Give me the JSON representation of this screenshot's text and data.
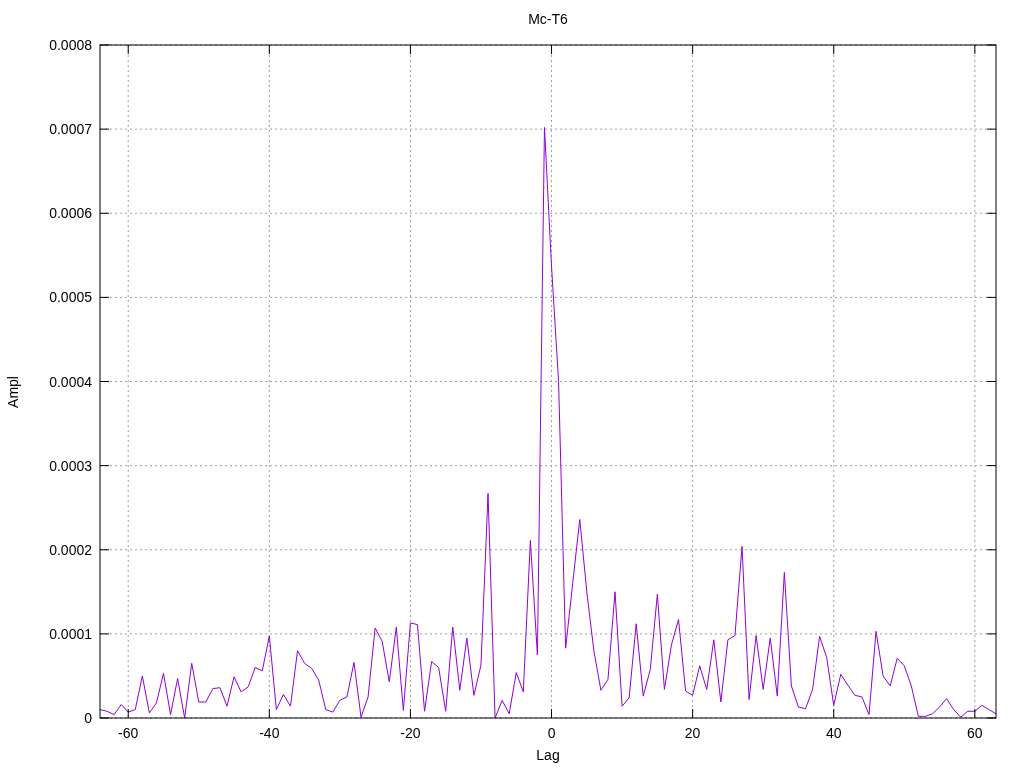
{
  "chart_data": {
    "type": "line",
    "title": "Mc-T6",
    "xlabel": "Lag",
    "ylabel": "Ampl",
    "x": [
      -64,
      -63,
      -62,
      -61,
      -60,
      -59,
      -58,
      -57,
      -56,
      -55,
      -54,
      -53,
      -52,
      -51,
      -50,
      -49,
      -48,
      -47,
      -46,
      -45,
      -44,
      -43,
      -42,
      -41,
      -40,
      -39,
      -38,
      -37,
      -36,
      -35,
      -34,
      -33,
      -32,
      -31,
      -30,
      -29,
      -28,
      -27,
      -26,
      -25,
      -24,
      -23,
      -22,
      -21,
      -20,
      -19,
      -18,
      -17,
      -16,
      -15,
      -14,
      -13,
      -12,
      -11,
      -10,
      -9,
      -8,
      -7,
      -6,
      -5,
      -4,
      -3,
      -2,
      -1,
      0,
      1,
      2,
      3,
      4,
      5,
      6,
      7,
      8,
      9,
      10,
      11,
      12,
      13,
      14,
      15,
      16,
      17,
      18,
      19,
      20,
      21,
      22,
      23,
      24,
      25,
      26,
      27,
      28,
      29,
      30,
      31,
      32,
      33,
      34,
      35,
      36,
      37,
      38,
      39,
      40,
      41,
      42,
      43,
      44,
      45,
      46,
      47,
      48,
      49,
      50,
      51,
      52,
      53,
      54,
      55,
      56,
      57,
      58,
      59,
      60,
      61,
      62,
      63
    ],
    "series": [
      {
        "color": "#9400d3",
        "values": [
          1e-05,
          8e-06,
          4e-06,
          1.6e-05,
          7e-06,
          1e-05,
          5e-05,
          6e-06,
          1.8e-05,
          5.3e-05,
          4e-06,
          4.7e-05,
          0,
          6.5e-05,
          1.9e-05,
          1.9e-05,
          3.5e-05,
          3.6e-05,
          1.4e-05,
          4.9e-05,
          3.1e-05,
          3.7e-05,
          6e-05,
          5.6e-05,
          9.75e-05,
          1e-05,
          2.8e-05,
          1.4e-05,
          8e-05,
          6.5e-05,
          5.9e-05,
          4.5e-05,
          1e-05,
          7e-06,
          2.1e-05,
          2.5e-05,
          6.6e-05,
          1e-06,
          2.5e-05,
          0.000107,
          9.1e-05,
          4.3e-05,
          0.000108,
          9e-06,
          0.000113,
          0.000111,
          8e-06,
          6.7e-05,
          6e-05,
          8e-06,
          0.000108,
          3.3e-05,
          9.5e-05,
          2.7e-05,
          6.3e-05,
          0.000267,
          0,
          2.1e-05,
          5e-06,
          5.4e-05,
          3.1e-05,
          0.000211,
          7.5e-05,
          0.000702,
          0.000537,
          0.0004,
          8.3e-05,
          0.00016,
          0.000236,
          0.00015,
          8e-05,
          3.3e-05,
          4.6e-05,
          0.00015,
          1.4e-05,
          2.4e-05,
          0.000112,
          2.6e-05,
          5.8e-05,
          0.000147,
          3.4e-05,
          8.7e-05,
          0.000117,
          3.2e-05,
          2.7e-05,
          6.2e-05,
          3.4e-05,
          9.3e-05,
          1.9e-05,
          9.3e-05,
          9.8e-05,
          0.000204,
          2.2e-05,
          9.8e-05,
          3.4e-05,
          9.5e-05,
          2.6e-05,
          0.000173,
          3.8e-05,
          1.3e-05,
          1.1e-05,
          3.4e-05,
          9.7e-05,
          7.2e-05,
          1.5e-05,
          5.2e-05,
          3.9e-05,
          2.7e-05,
          2.5e-05,
          4e-06,
          0.000103,
          5e-05,
          3.8e-05,
          7.1e-05,
          6.2e-05,
          3.8e-05,
          2e-06,
          2e-06,
          5e-06,
          1.3e-05,
          2.3e-05,
          1e-05,
          1e-06,
          8e-06,
          8e-06,
          1.5e-05,
          1e-05,
          5e-06
        ]
      }
    ],
    "grid": true,
    "xlim": [
      -64,
      63
    ],
    "ylim": [
      0,
      0.0008
    ],
    "xticks": [
      -60,
      -40,
      -20,
      0,
      20,
      40,
      60
    ],
    "yticks": [
      {
        "value": 0,
        "label": "0"
      },
      {
        "value": 0.0001,
        "label": "0.0001"
      },
      {
        "value": 0.0002,
        "label": "0.0002"
      },
      {
        "value": 0.0003,
        "label": "0.0003"
      },
      {
        "value": 0.0004,
        "label": "0.0004"
      },
      {
        "value": 0.0005,
        "label": "0.0005"
      },
      {
        "value": 0.0006,
        "label": "0.0006"
      },
      {
        "value": 0.0007,
        "label": "0.0007"
      },
      {
        "value": 0.0008,
        "label": "0.0008"
      }
    ]
  }
}
